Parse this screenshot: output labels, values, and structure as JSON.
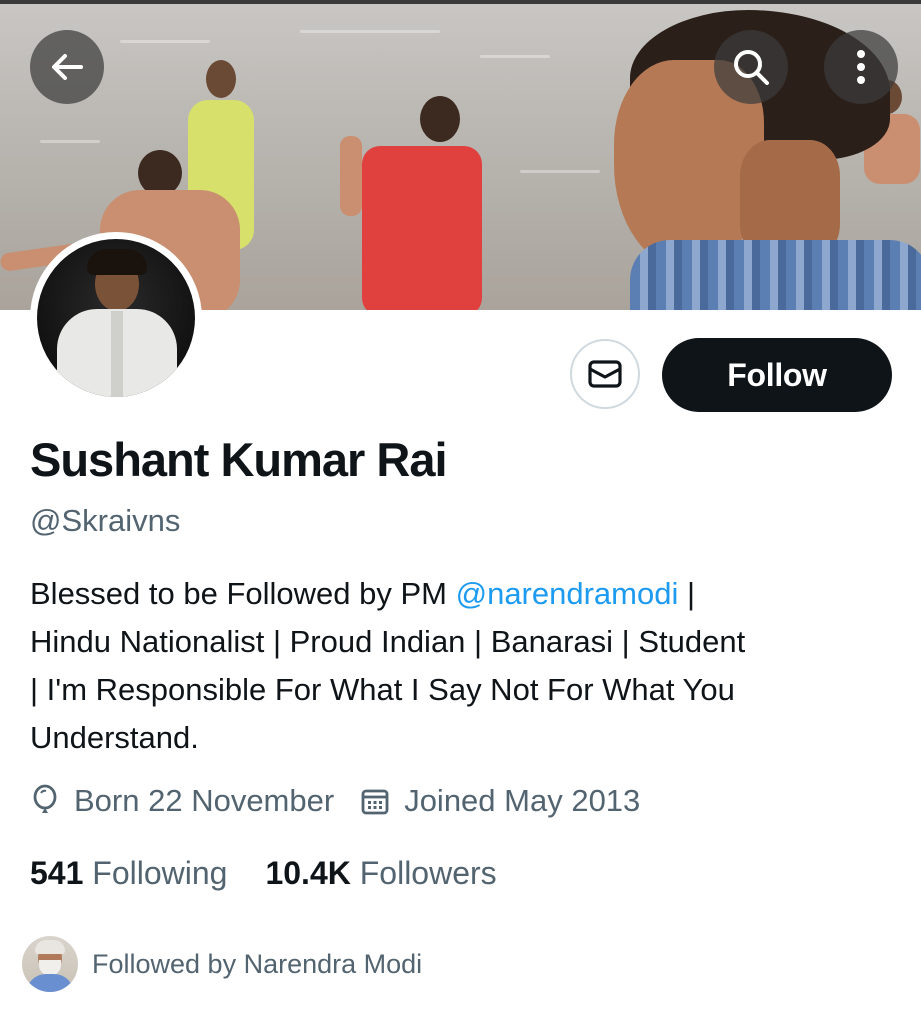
{
  "header": {
    "back_icon": "arrow-left-icon",
    "search_icon": "search-icon",
    "more_icon": "more-vertical-icon"
  },
  "profile": {
    "name": "Sushant Kumar Rai",
    "handle": "@Skraivns",
    "bio_prefix": "Blessed to be Followed by PM ",
    "bio_mention": "@narendramodi",
    "bio_line1_suffix": " |",
    "bio_line2": "Hindu Nationalist | Proud Indian | Banarasi | Student",
    "bio_line3": "| I'm Responsible For What I Say Not For What You",
    "bio_line4": "Understand.",
    "born": "Born 22 November",
    "joined": "Joined May 2013"
  },
  "actions": {
    "message_icon": "envelope-icon",
    "follow_label": "Follow"
  },
  "stats": {
    "following_count": "541",
    "following_label": "Following",
    "followers_count": "10.4K",
    "followers_label": "Followers"
  },
  "followed_by": {
    "text": "Followed by Narendra Modi"
  },
  "colors": {
    "accent": "#1d9bf0",
    "follow_bg": "#0f1419",
    "secondary_text": "#536471"
  }
}
